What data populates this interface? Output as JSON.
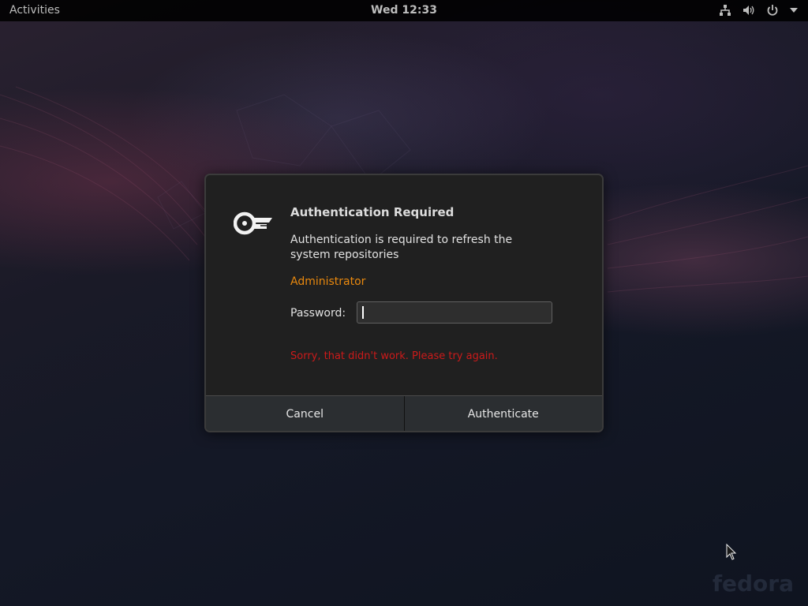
{
  "topbar": {
    "activities": "Activities",
    "clock": "Wed 12:33",
    "icons": [
      "network-icon",
      "volume-icon",
      "power-icon",
      "chevron-down-icon"
    ]
  },
  "dialog": {
    "icon": "key-icon",
    "title": "Authentication Required",
    "description": "Authentication is required to refresh the system repositories",
    "user": "Administrator",
    "password_label": "Password:",
    "password_value": "",
    "error": "Sorry, that didn't work. Please try again.",
    "cancel_label": "Cancel",
    "authenticate_label": "Authenticate"
  },
  "branding": {
    "logo_text": "fedora"
  },
  "colors": {
    "accent_user": "#e8880e",
    "error": "#cc1a1a",
    "dialog_bg": "#202020",
    "button_bg": "#2b2e31"
  }
}
